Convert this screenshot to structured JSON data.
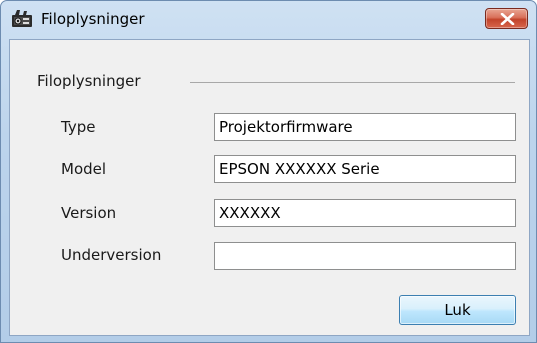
{
  "window": {
    "title": "Filoplysninger",
    "icon": "projector-icon",
    "close_icon": "close-x-icon"
  },
  "group": {
    "label": "Filoplysninger"
  },
  "fields": [
    {
      "label": "Type",
      "value": "Projektorfirmware"
    },
    {
      "label": "Model",
      "value": "EPSON XXXXXX Serie"
    },
    {
      "label": "Version",
      "value": "XXXXXX"
    },
    {
      "label": "Underversion",
      "value": ""
    }
  ],
  "buttons": {
    "close_label": "Luk"
  },
  "colors": {
    "titlebar": "#bcd4ec",
    "close_button": "#c2432b",
    "dialog_background": "#f0f0f0",
    "button_accent": "#a7d9f5"
  }
}
